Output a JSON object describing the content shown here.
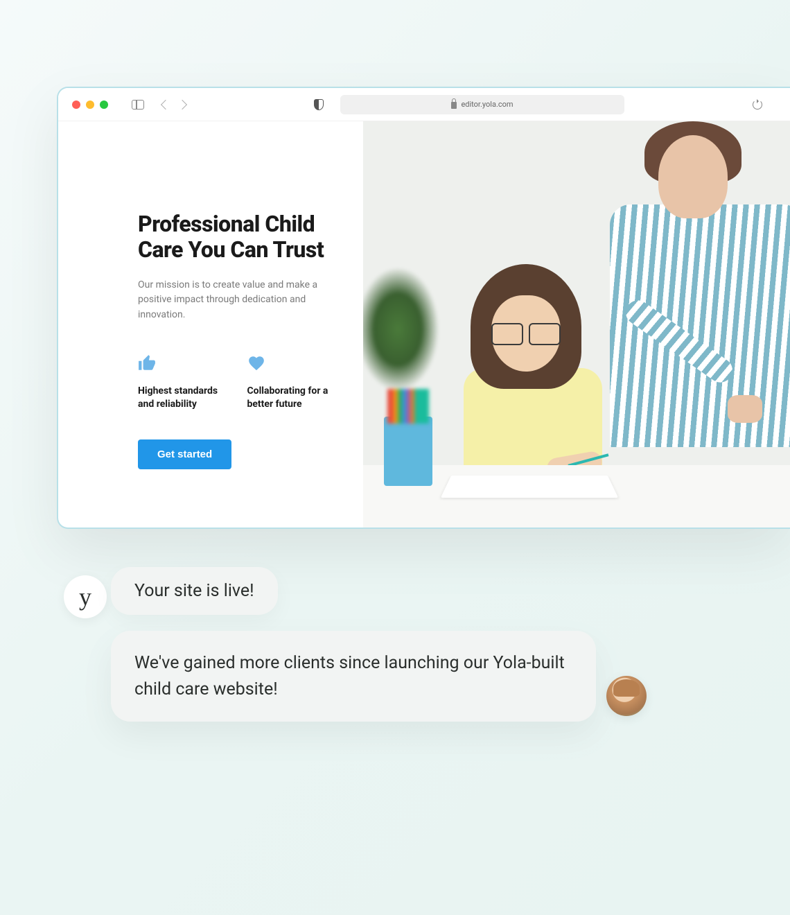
{
  "browser": {
    "url": "editor.yola.com"
  },
  "page": {
    "title": "Professional Child Care You Can Trust",
    "mission": "Our mission is to create value and make a positive impact through dedication and innovation.",
    "features": [
      {
        "icon": "thumb-up",
        "text": "Highest standards and reliability"
      },
      {
        "icon": "heart",
        "text": "Collaborating for a better future"
      }
    ],
    "cta_label": "Get started"
  },
  "chat": {
    "avatar_letter": "y",
    "message1": "Your site is live!",
    "message2": "We've gained more clients since launching our Yola-built child care website!"
  }
}
